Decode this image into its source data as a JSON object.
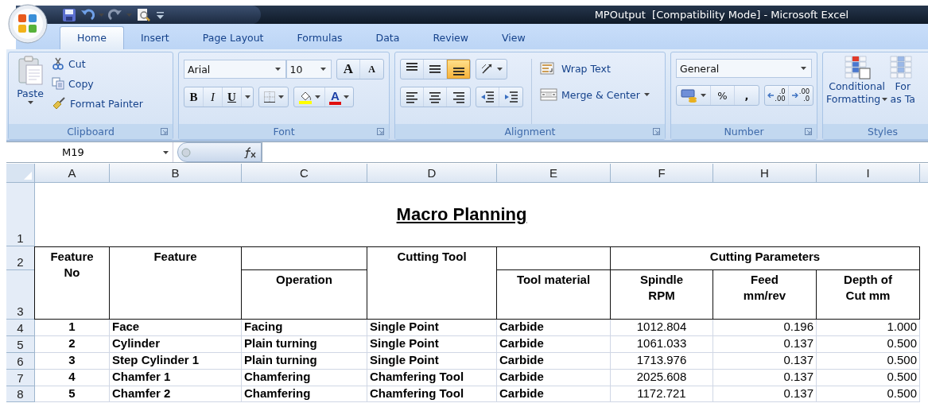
{
  "window": {
    "title": "MPOutput  [Compatibility Mode] - Microsoft Excel"
  },
  "tabs": [
    {
      "label": "Home",
      "selected": true
    },
    {
      "label": "Insert",
      "selected": false
    },
    {
      "label": "Page Layout",
      "selected": false
    },
    {
      "label": "Formulas",
      "selected": false
    },
    {
      "label": "Data",
      "selected": false
    },
    {
      "label": "Review",
      "selected": false
    },
    {
      "label": "View",
      "selected": false
    }
  ],
  "ribbon": {
    "clipboard": {
      "label": "Clipboard",
      "paste": "Paste",
      "cut": "Cut",
      "copy": "Copy",
      "format_painter": "Format Painter"
    },
    "font": {
      "label": "Font",
      "font_name": "Arial",
      "font_size": "10",
      "grow": "A",
      "shrink": "A",
      "bold": "B",
      "italic": "I",
      "underline": "U",
      "font_color": "A"
    },
    "alignment": {
      "label": "Alignment",
      "vertical": [
        {
          "kind": "top",
          "selected": false
        },
        {
          "kind": "middle",
          "selected": false
        },
        {
          "kind": "bottom",
          "selected": true
        }
      ],
      "horizontal": [
        {
          "kind": "left"
        },
        {
          "kind": "center"
        },
        {
          "kind": "right"
        }
      ],
      "wrap_text": "Wrap Text",
      "merge_center": "Merge & Center"
    },
    "number": {
      "label": "Number",
      "format": "General",
      "percent": "%",
      "comma": ",",
      "increase_decimal": [
        ".0",
        ".00"
      ],
      "decrease_decimal": [
        ".00",
        ".0"
      ]
    },
    "styles": {
      "label": "Styles",
      "conditional_formatting": [
        "Conditional",
        "Formatting"
      ],
      "format_as_table": [
        "For",
        "as Ta"
      ]
    }
  },
  "formula_bar": {
    "name_box": "M19"
  },
  "sheet": {
    "columns": [
      "A",
      "B",
      "C",
      "D",
      "E",
      "F",
      "H",
      "I"
    ],
    "row_numbers": [
      "1",
      "2",
      "3",
      "4",
      "5",
      "6",
      "7",
      "8"
    ],
    "title": "Macro Planning",
    "header": {
      "feature_no": "Feature No",
      "feature": "Feature",
      "operation": "Operation",
      "cutting_tool": "Cutting Tool",
      "tool_material": "Tool material",
      "cutting_parameters": "Cutting Parameters",
      "spindle_rpm": "Spindle RPM",
      "feed": "Feed mm/rev",
      "depth_of_cut": "Depth of Cut mm"
    },
    "rows": [
      {
        "no": "1",
        "feature": "Face",
        "operation": "Facing",
        "tool": "Single Point",
        "material": "Carbide",
        "rpm": "1012.804",
        "feed": "0.196",
        "depth": "1.000"
      },
      {
        "no": "2",
        "feature": "Cylinder",
        "operation": "Plain turning",
        "tool": "Single Point",
        "material": "Carbide",
        "rpm": "1061.033",
        "feed": "0.137",
        "depth": "0.500"
      },
      {
        "no": "3",
        "feature": "Step Cylinder 1",
        "operation": "Plain turning",
        "tool": "Single Point",
        "material": "Carbide",
        "rpm": "1713.976",
        "feed": "0.137",
        "depth": "0.500"
      },
      {
        "no": "4",
        "feature": "Chamfer 1",
        "operation": "Chamfering",
        "tool": "Chamfering Tool",
        "material": "Carbide",
        "rpm": "2025.608",
        "feed": "0.137",
        "depth": "0.500"
      },
      {
        "no": "5",
        "feature": "Chamfer 2",
        "operation": "Chamfering",
        "tool": "Chamfering Tool",
        "material": "Carbide",
        "rpm": "1172.721",
        "feed": "0.137",
        "depth": "0.500"
      }
    ]
  }
}
